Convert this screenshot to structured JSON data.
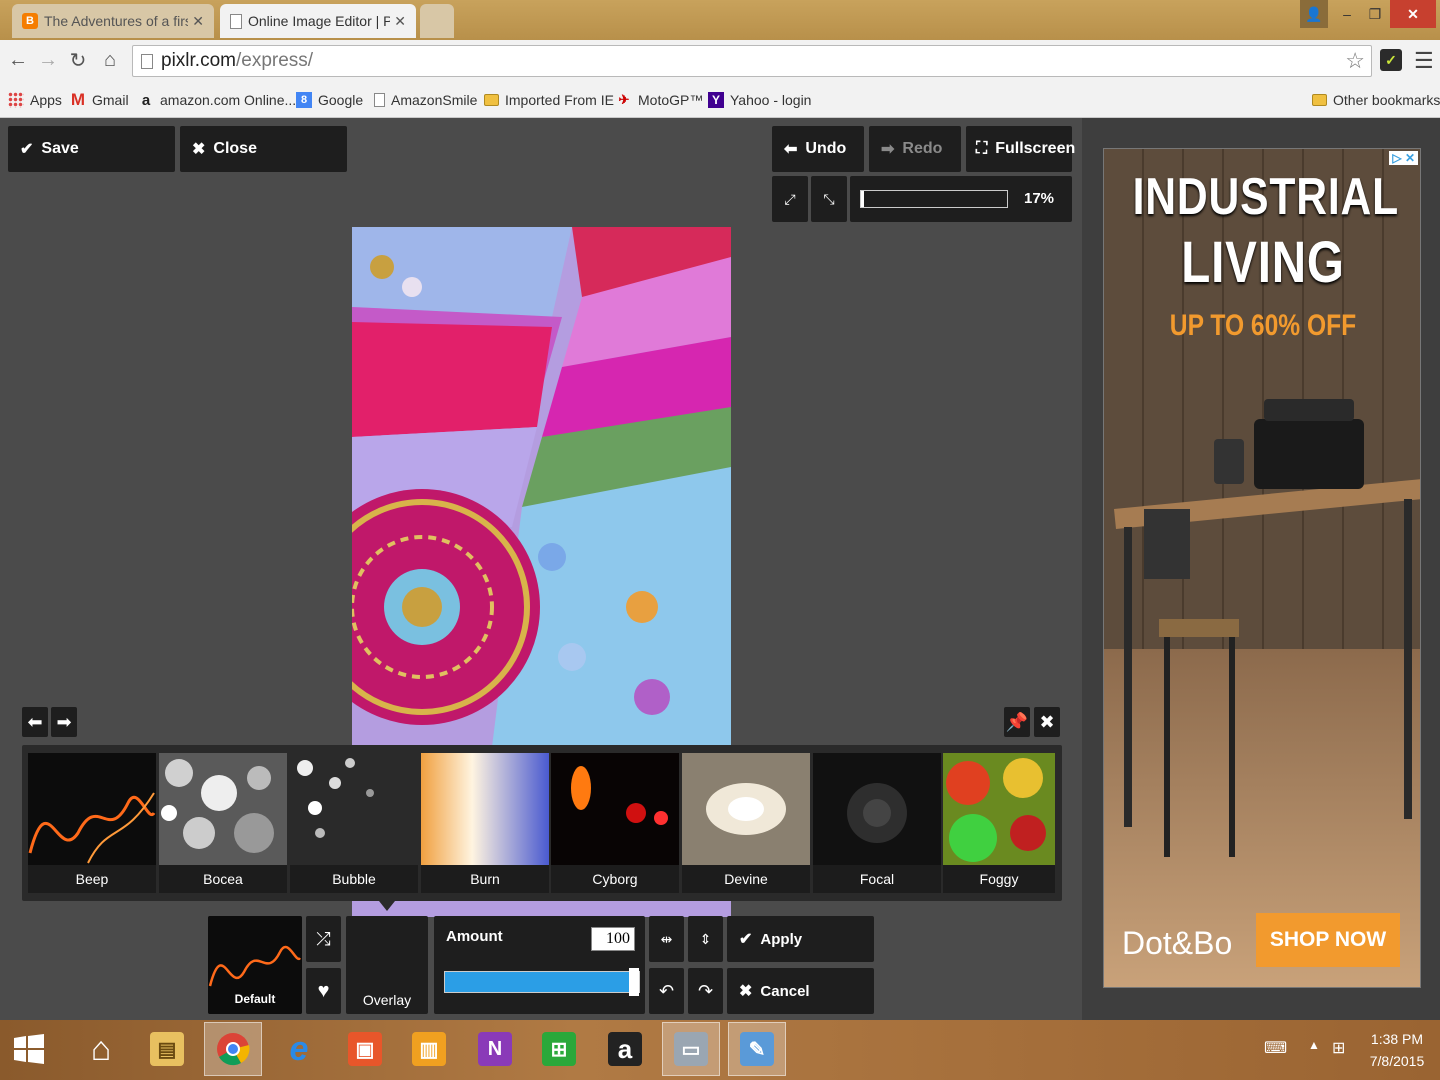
{
  "browser": {
    "tabs": [
      {
        "title": "The Adventures of a first t",
        "active": false
      },
      {
        "title": "Online Image Editor | Pixlr",
        "active": true
      }
    ],
    "url": {
      "host": "pixlr.com",
      "path": "/express/"
    },
    "bookmarks": [
      {
        "label": "Apps",
        "icon": "apps-grid-icon"
      },
      {
        "label": "Gmail",
        "icon": "gmail-icon"
      },
      {
        "label": "amazon.com Online...",
        "icon": "amazon-icon"
      },
      {
        "label": "Google",
        "icon": "google-icon"
      },
      {
        "label": "AmazonSmile",
        "icon": "page-icon"
      },
      {
        "label": "Imported From IE",
        "icon": "folder-icon"
      },
      {
        "label": "MotoGP™",
        "icon": "motogp-icon"
      },
      {
        "label": "Yahoo - login",
        "icon": "yahoo-icon"
      }
    ],
    "other_bookmarks": "Other bookmarks"
  },
  "editor": {
    "save_label": "Save",
    "close_label": "Close",
    "undo_label": "Undo",
    "redo_label": "Redo",
    "fullscreen_label": "Fullscreen",
    "zoom_percent": "17%",
    "zoom_level": 0.02,
    "effects": [
      {
        "label": "Beep"
      },
      {
        "label": "Bocea"
      },
      {
        "label": "Bubble"
      },
      {
        "label": "Burn"
      },
      {
        "label": "Cyborg"
      },
      {
        "label": "Devine"
      },
      {
        "label": "Focal"
      },
      {
        "label": "Foggy"
      }
    ],
    "selected_effect": "Default",
    "overlay_label": "Overlay",
    "amount_label": "Amount",
    "amount_value": "100",
    "amount_level": 1.0,
    "apply_label": "Apply",
    "cancel_label": "Cancel"
  },
  "ad": {
    "title_line1": "INDUSTRIAL",
    "title_line2": "LIVING",
    "offer": "UP TO 60% OFF",
    "brand": "Dot&Bo",
    "cta": "SHOP NOW"
  },
  "taskbar": {
    "time": "1:38 PM",
    "date": "7/8/2015"
  },
  "colors": {
    "accent_blue": "#2b9ee6",
    "ad_orange": "#f29a2e",
    "panel_dark": "#1e1e1e",
    "workspace": "#4b4b4b"
  }
}
